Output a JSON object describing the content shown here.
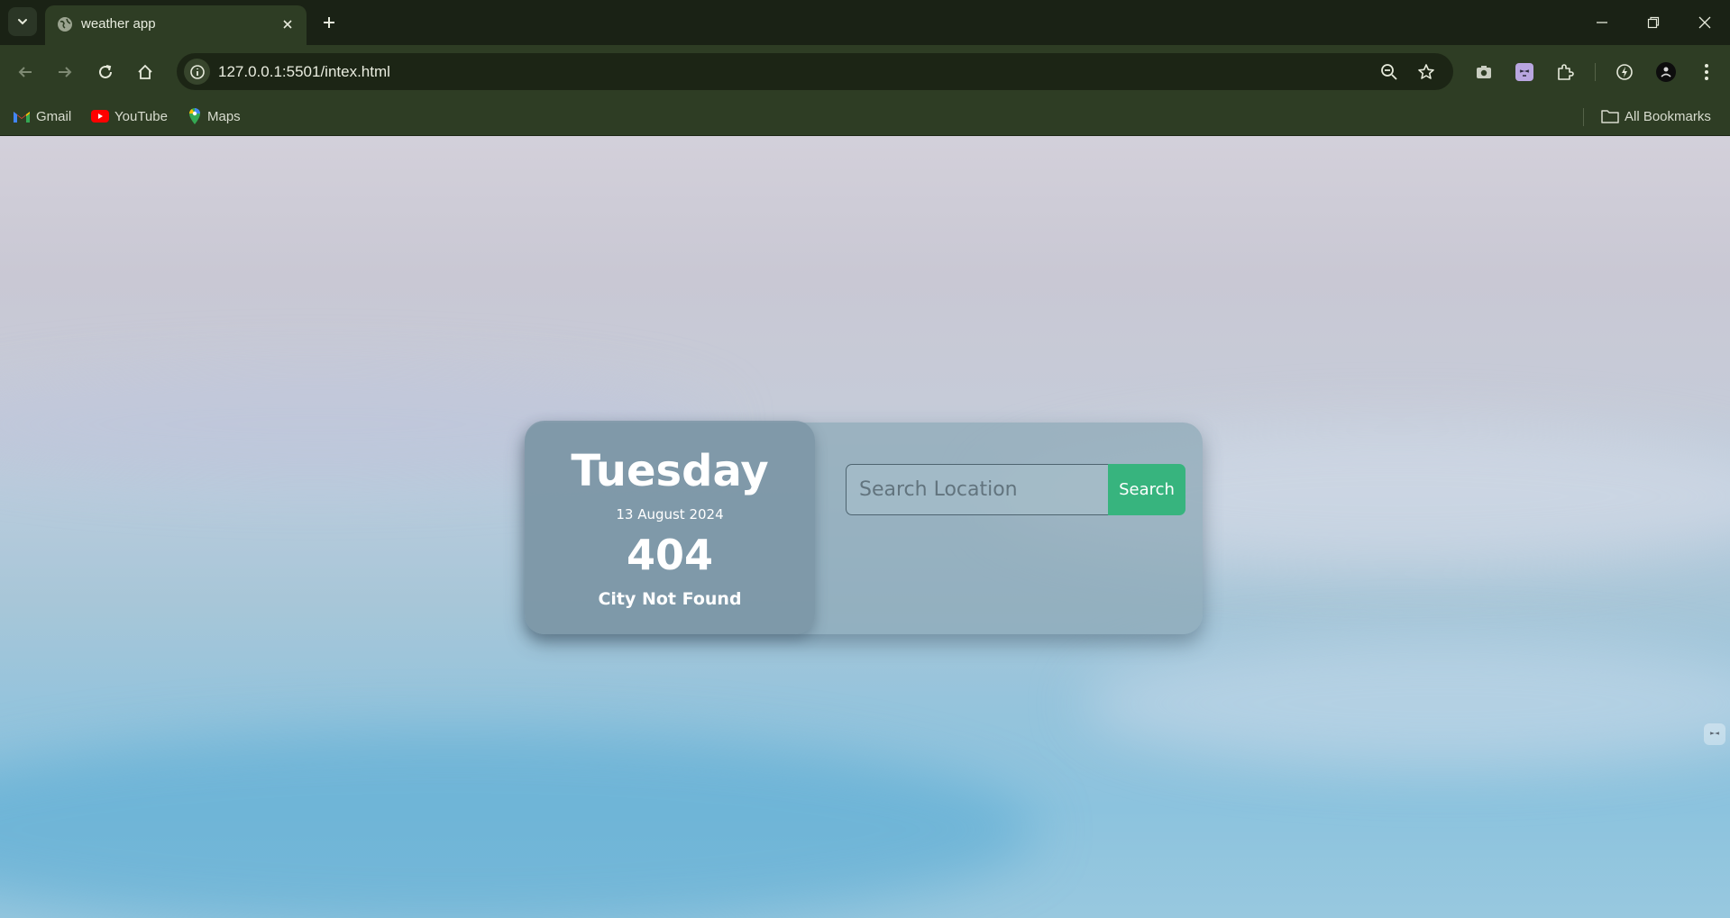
{
  "browser": {
    "tab": {
      "title": "weather app",
      "favicon": "globe-icon"
    },
    "address_bar": {
      "url": "127.0.0.1:5501/intex.html"
    },
    "bookmarks": [
      {
        "label": "Gmail",
        "icon": "gmail-icon"
      },
      {
        "label": "YouTube",
        "icon": "youtube-icon"
      },
      {
        "label": "Maps",
        "icon": "maps-icon"
      }
    ],
    "all_bookmarks_label": "All Bookmarks"
  },
  "weather": {
    "day": "Tuesday",
    "date": "13 August 2024",
    "temperature": "404",
    "description": "City Not Found"
  },
  "search": {
    "placeholder": "Search Location",
    "value": "",
    "button_label": "Search",
    "button_color": "#37b47e"
  },
  "colors": {
    "chrome_bg": "#2e3d24",
    "tabstrip_bg": "#1a2215"
  }
}
